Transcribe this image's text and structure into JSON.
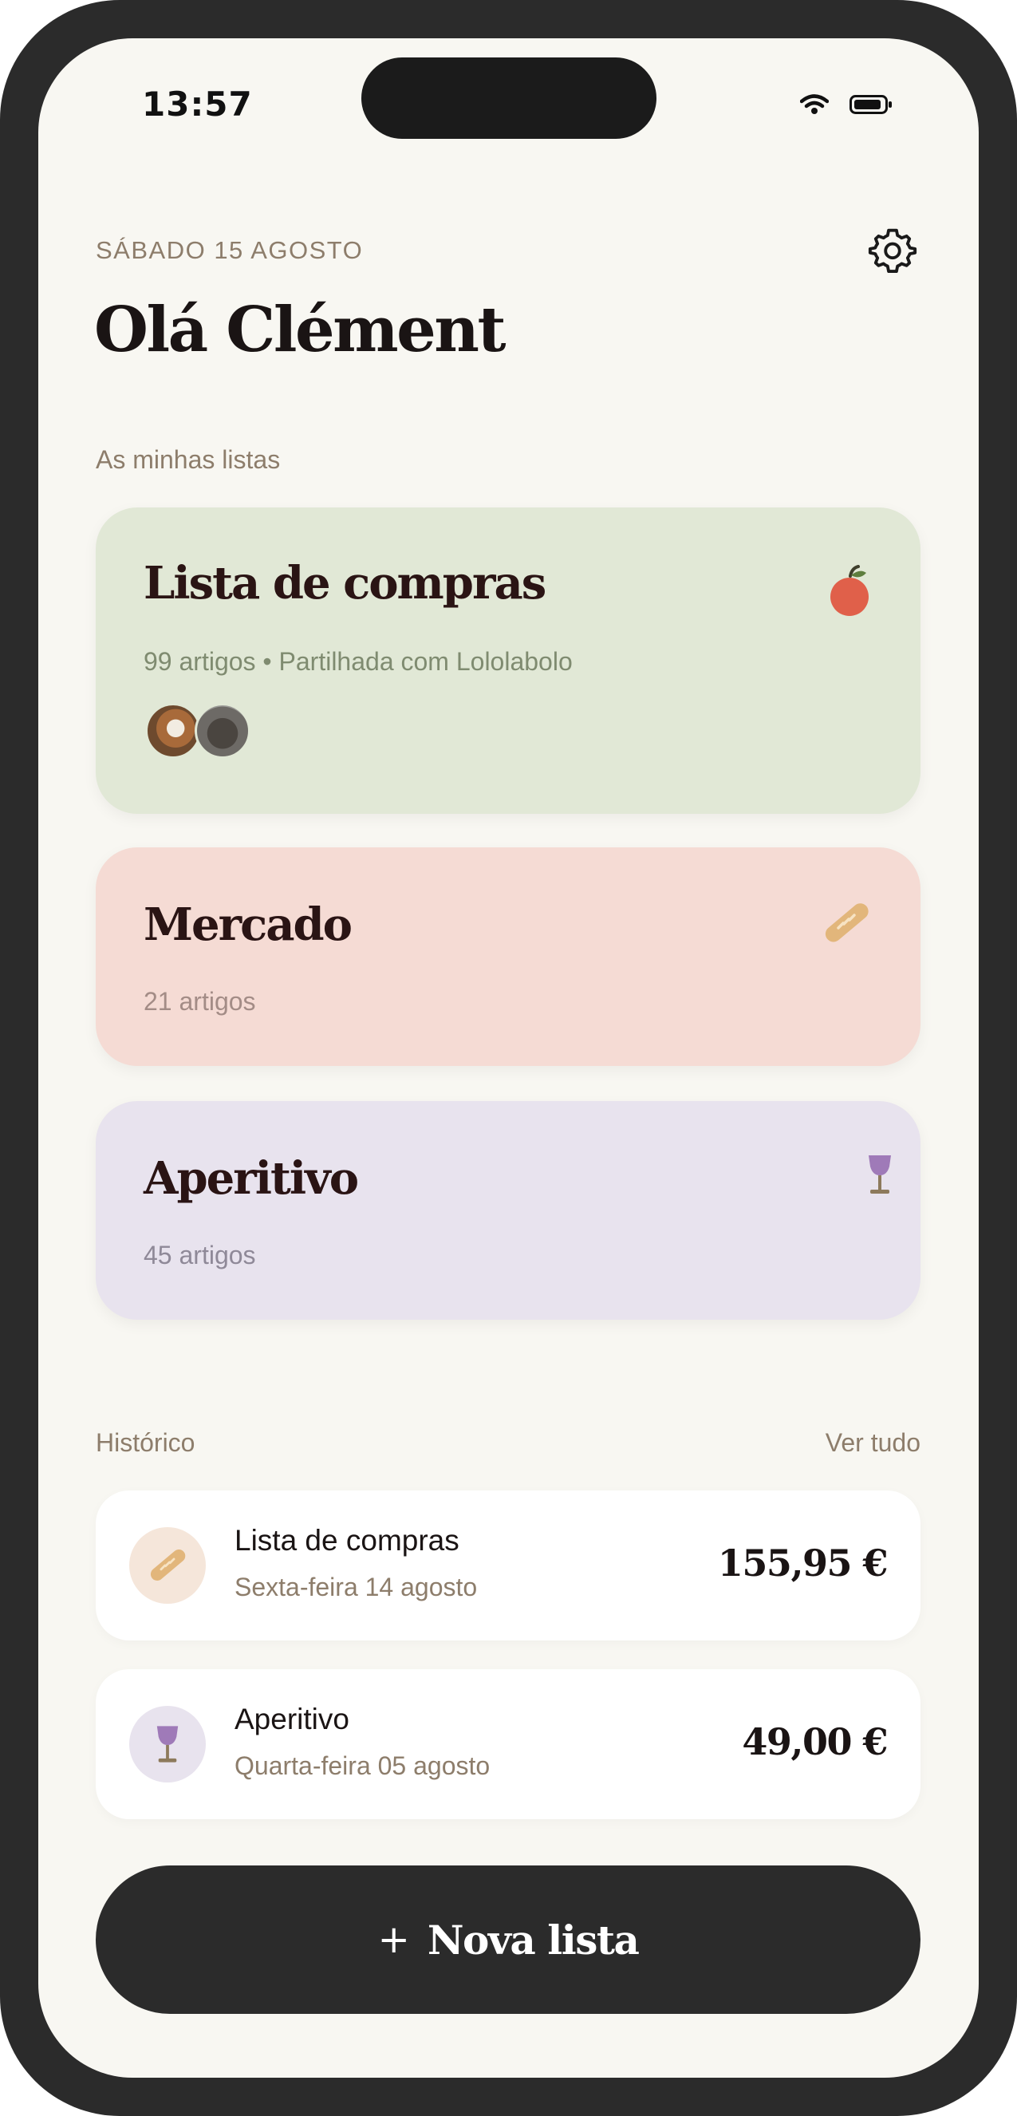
{
  "status_bar": {
    "time": "13:57",
    "wifi_icon": "wifi-icon",
    "battery_icon": "battery-icon"
  },
  "header": {
    "date": "SÁBADO 15 AGOSTO",
    "greeting": "Olá Clément",
    "settings_icon": "gear-icon"
  },
  "lists_section": {
    "label": "As minhas listas",
    "lists": [
      {
        "title": "Lista de compras",
        "subtitle": "99 artigos • Partilhada com Lololabolo",
        "icon": "apple-icon",
        "color": "#e1e8d6",
        "avatars": [
          "dog-avatar",
          "cat-avatar"
        ]
      },
      {
        "title": "Mercado",
        "subtitle": "21 artigos",
        "icon": "baguette-icon",
        "color": "#f5dbd4"
      },
      {
        "title": "Aperitivo",
        "subtitle": "45 artigos",
        "icon": "wine-glass-icon",
        "color": "#e8e3ee"
      }
    ]
  },
  "history": {
    "label": "Histórico",
    "see_all": "Ver tudo",
    "items": [
      {
        "title": "Lista de compras",
        "date": "Sexta-feira 14 agosto",
        "amount": "155,95 €",
        "icon": "baguette-icon",
        "icon_bg": "#f5e6da"
      },
      {
        "title": "Aperitivo",
        "date": "Quarta-feira 05 agosto",
        "amount": "49,00 €",
        "icon": "wine-glass-icon",
        "icon_bg": "#e8e3ee"
      }
    ]
  },
  "new_list_button": {
    "plus": "+",
    "label": "Nova lista"
  }
}
